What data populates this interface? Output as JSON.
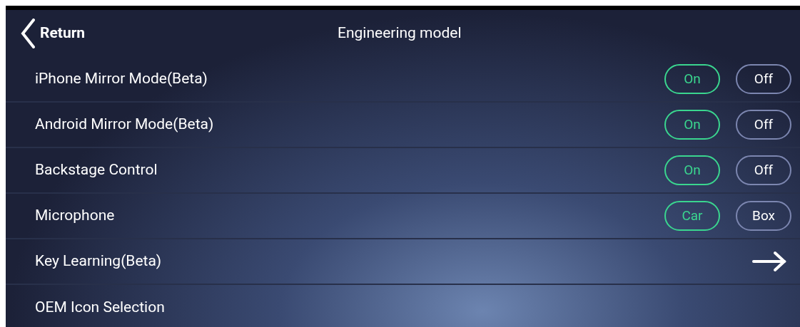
{
  "header": {
    "back_label": "Return",
    "title": "Engineering model"
  },
  "rows": [
    {
      "kind": "toggle",
      "label": "iPhone Mirror Mode(Beta)",
      "options": [
        {
          "label": "On",
          "selected": true
        },
        {
          "label": "Off",
          "selected": false
        }
      ]
    },
    {
      "kind": "toggle",
      "label": "Android Mirror Mode(Beta)",
      "options": [
        {
          "label": "On",
          "selected": true
        },
        {
          "label": "Off",
          "selected": false
        }
      ]
    },
    {
      "kind": "toggle",
      "label": "Backstage Control",
      "options": [
        {
          "label": "On",
          "selected": true
        },
        {
          "label": "Off",
          "selected": false
        }
      ]
    },
    {
      "kind": "toggle",
      "label": "Microphone",
      "options": [
        {
          "label": "Car",
          "selected": true
        },
        {
          "label": "Box",
          "selected": false
        }
      ]
    },
    {
      "kind": "link",
      "label": "Key Learning(Beta)"
    },
    {
      "kind": "plain",
      "label": "OEM Icon Selection"
    }
  ]
}
